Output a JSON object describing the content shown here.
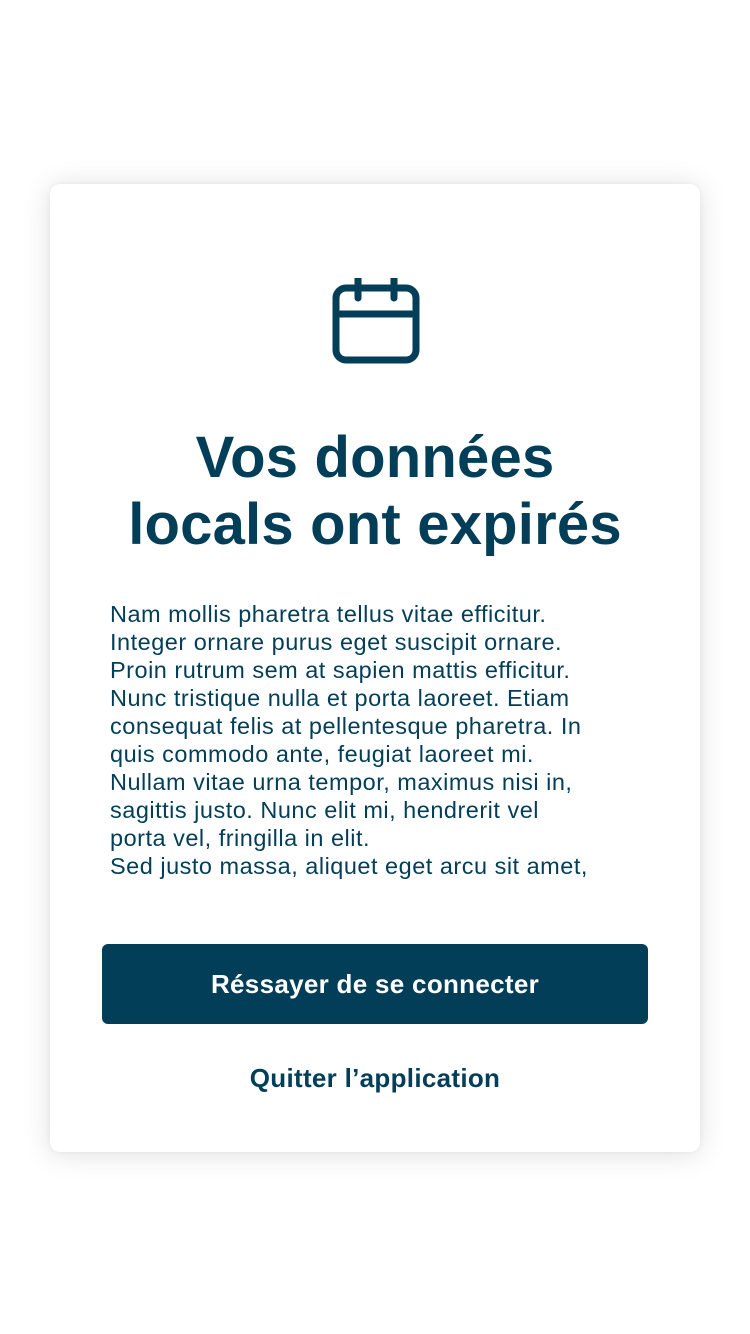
{
  "icon": "calendar-icon",
  "title_lines": [
    "Vos données",
    "locals ont expirés"
  ],
  "body_lines": [
    "Nam mollis pharetra tellus vitae efficitur.",
    "Integer ornare purus eget suscipit ornare.",
    "Proin rutrum sem at sapien mattis efficitur.",
    "Nunc tristique nulla et porta laoreet. Etiam",
    "consequat felis at pellentesque pharetra. In",
    "quis commodo ante, feugiat laoreet mi.",
    "Nullam vitae urna tempor, maximus nisi in,",
    "sagittis justo. Nunc elit mi, hendrerit vel",
    "porta vel, fringilla in elit.",
    "Sed justo massa, aliquet eget arcu sit amet,"
  ],
  "primary_button_label": "Réssayer de se connecter",
  "secondary_button_label": "Quitter l’application",
  "colors": {
    "primary": "#023e58",
    "background": "#ffffff"
  }
}
